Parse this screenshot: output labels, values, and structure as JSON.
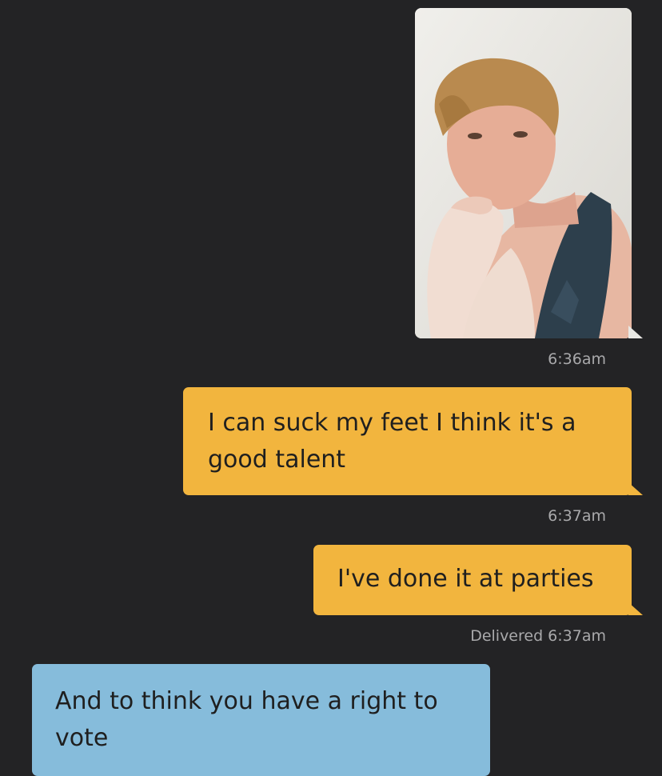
{
  "messages": [
    {
      "kind": "photo",
      "direction": "outgoing",
      "image": "selfie-photo",
      "time": "6:36am"
    },
    {
      "kind": "text",
      "direction": "outgoing",
      "text": "I can suck my feet I think it's a good talent",
      "time": "6:37am"
    },
    {
      "kind": "text",
      "direction": "outgoing",
      "text": "I've done it at parties",
      "status": "Delivered 6:37am"
    },
    {
      "kind": "text",
      "direction": "incoming",
      "text": "And to think you have a right to vote"
    }
  ],
  "colors": {
    "background": "#232325",
    "outgoing_bubble": "#f2b53e",
    "incoming_bubble": "#86bcdb",
    "timestamp": "#a9a9ab"
  }
}
